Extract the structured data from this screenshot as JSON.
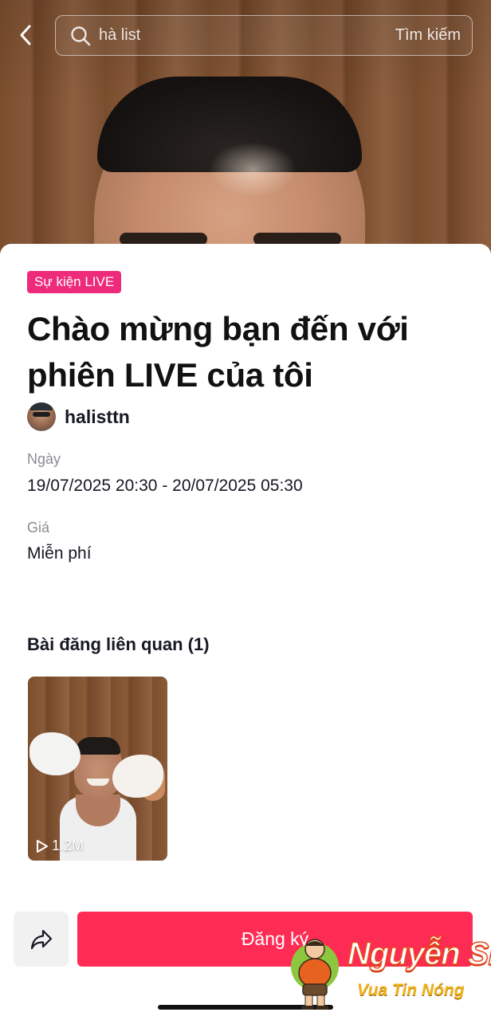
{
  "header": {
    "search_query": "hà list",
    "search_action": "Tìm kiếm"
  },
  "event": {
    "badge": "Sự kiện LIVE",
    "title": "Chào mừng bạn đến với phiên LIVE của tôi",
    "host": "halisttn",
    "date_label": "Ngày",
    "date_value": "19/07/2025 20:30 - 20/07/2025 05:30",
    "price_label": "Giá",
    "price_value": "Miễn phí"
  },
  "related": {
    "title": "Bài đăng liên quan (1)",
    "posts": [
      {
        "views": "1.2M"
      }
    ]
  },
  "actions": {
    "register_label": "Đăng ký"
  },
  "watermark": {
    "name": "Nguyễn Sin",
    "tagline": "Vua Tin Nóng"
  },
  "colors": {
    "badge": "#ee2b7a",
    "primary_button": "#fe2c55"
  }
}
